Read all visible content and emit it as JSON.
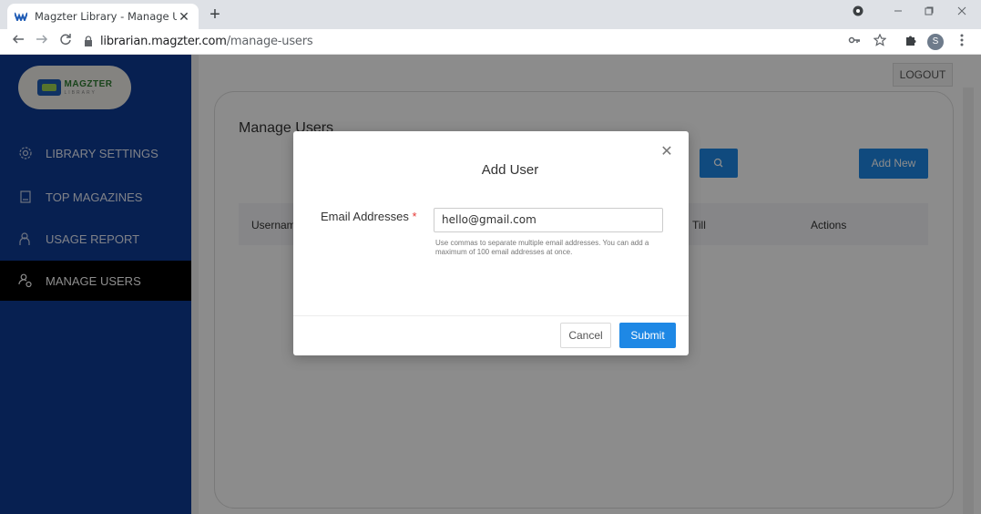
{
  "browser": {
    "tab_title": "Magzter Library - Manage Users",
    "tab_close": "✕",
    "new_tab": "+",
    "url_domain": "librarian.magzter.com",
    "url_path": "/manage-users",
    "profile_initial": "S"
  },
  "sidebar": {
    "logo": {
      "main": "MAGZTER",
      "sub": "LIBRARY"
    },
    "items": [
      {
        "label": "LIBRARY SETTINGS",
        "icon": "settings-icon",
        "active": false
      },
      {
        "label": "TOP MAGAZINES",
        "icon": "magazine-icon",
        "active": false
      },
      {
        "label": "USAGE REPORT",
        "icon": "user-report-icon",
        "active": false
      },
      {
        "label": "MANAGE USERS",
        "icon": "users-icon",
        "active": true
      }
    ]
  },
  "header": {
    "logout_label": "LOGOUT"
  },
  "page": {
    "title": "Manage Users",
    "add_new_label": "Add New",
    "table_headers": {
      "username": "Usernam",
      "valid_till": "Till",
      "actions": "Actions"
    }
  },
  "modal": {
    "title": "Add User",
    "close": "✕",
    "field_label": "Email Addresses",
    "required_mark": "*",
    "email_value": "hello@gmail.com",
    "help_text": "Use commas to separate multiple email addresses. You can add a maximum of 100 email addresses at once.",
    "cancel_label": "Cancel",
    "submit_label": "Submit"
  },
  "colors": {
    "sidebar_bg": "#0d3b94",
    "accent_blue": "#1e88e5",
    "active_nav_bg": "#000000"
  }
}
